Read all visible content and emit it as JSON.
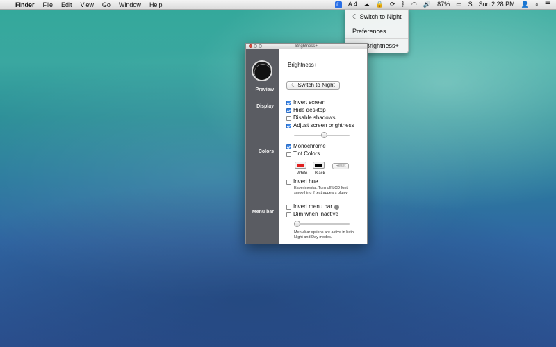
{
  "menubar": {
    "apple": "",
    "app": "Finder",
    "menus": [
      "File",
      "Edit",
      "View",
      "Go",
      "Window",
      "Help"
    ],
    "status": {
      "brightness_icon": "☾",
      "adobe_count": "4",
      "battery": "87%",
      "clock": "Sun 2:28 PM"
    }
  },
  "dropdown": {
    "switch": "☾  Switch to Night",
    "preferences": "Preferences...",
    "quit": "Quit Brightness+"
  },
  "window": {
    "title": "Brightness+",
    "app_name": "Brightness+",
    "sections": {
      "preview": "Preview",
      "display": "Display",
      "colors": "Colors",
      "menubar": "Menu bar"
    },
    "preview_button": "☾  Switch to Night",
    "display": {
      "invert_screen": {
        "label": "Invert screen",
        "checked": true
      },
      "hide_desktop": {
        "label": "Hide desktop",
        "checked": true
      },
      "disable_shadows": {
        "label": "Disable shadows",
        "checked": false
      },
      "adjust_brightness": {
        "label": "Adjust screen brightness",
        "checked": true
      },
      "brightness_level": 0.55
    },
    "colors": {
      "monochrome": {
        "label": "Monochrome",
        "checked": true
      },
      "tint_colors": {
        "label": "Tint Colors",
        "checked": false
      },
      "white_label": "White",
      "black_label": "Black",
      "white_color": "#e02020",
      "black_color": "#000000",
      "reset": "Reset",
      "invert_hue": {
        "label": "Invert hue",
        "checked": false
      },
      "note": "Experimental. Turn off LCD font smoothing if text appears blurry"
    },
    "menu_bar": {
      "invert_menu_bar": {
        "label": "Invert menu bar",
        "checked": false
      },
      "dim_when_inactive": {
        "label": "Dim when inactive",
        "checked": false
      },
      "dim_level": 0.0,
      "note": "Menu bar options are active in both Night and Day modes."
    }
  }
}
